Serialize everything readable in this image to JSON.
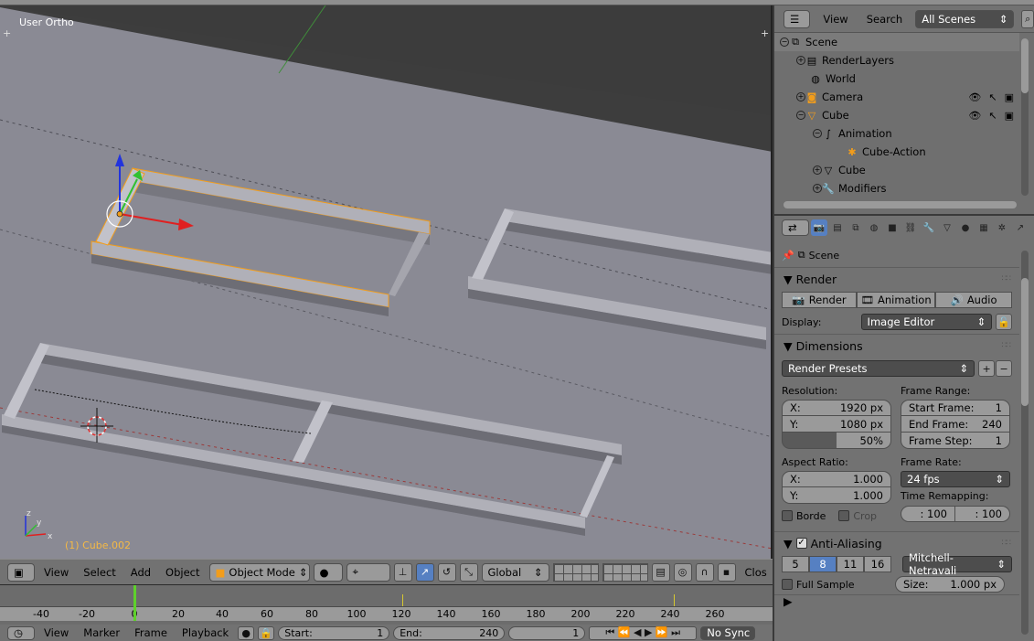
{
  "viewport": {
    "view_name": "User Ortho",
    "object_name": "(1) Cube.002",
    "axis_labels": {
      "x": "x",
      "y": "y",
      "z": "z"
    }
  },
  "view3d_header": {
    "menus": [
      "View",
      "Select",
      "Add",
      "Object"
    ],
    "mode": "Object Mode",
    "orientation": "Global",
    "truncated_label": "Clos"
  },
  "timeline": {
    "ticks": [
      "-40",
      "-20",
      "0",
      "20",
      "40",
      "60",
      "80",
      "100",
      "120",
      "140",
      "160",
      "180",
      "200",
      "220",
      "240",
      "260"
    ],
    "current_frame": 0,
    "menus": [
      "View",
      "Marker",
      "Frame",
      "Playback"
    ],
    "start_label": "Start:",
    "start_value": "1",
    "end_label": "End:",
    "end_value": "240",
    "current_value": "1",
    "sync": "No Sync"
  },
  "outliner": {
    "menus": [
      "View",
      "Search"
    ],
    "scene_filter": "All Scenes",
    "items": [
      {
        "label": "Scene",
        "level": 0,
        "icon": "scene-icon"
      },
      {
        "label": "RenderLayers",
        "level": 1,
        "icon": "renderlayers-icon"
      },
      {
        "label": "World",
        "level": 1,
        "icon": "world-icon"
      },
      {
        "label": "Camera",
        "level": 1,
        "icon": "camera-icon"
      },
      {
        "label": "Cube",
        "level": 1,
        "icon": "mesh-object-icon"
      },
      {
        "label": "Animation",
        "level": 2,
        "icon": "animation-icon"
      },
      {
        "label": "Cube-Action",
        "level": 3,
        "icon": "action-icon"
      },
      {
        "label": "Cube",
        "level": 2,
        "icon": "mesh-data-icon"
      },
      {
        "label": "Modifiers",
        "level": 2,
        "icon": "wrench-icon"
      }
    ]
  },
  "properties": {
    "context": "Scene",
    "render_panel": {
      "title": "Render",
      "buttons": [
        "Render",
        "Animation",
        "Audio"
      ],
      "display_label": "Display:",
      "display_value": "Image Editor"
    },
    "dimensions_panel": {
      "title": "Dimensions",
      "presets": "Render Presets",
      "resolution_label": "Resolution:",
      "res_x_label": "X:",
      "res_x": "1920 px",
      "res_y_label": "Y:",
      "res_y": "1080 px",
      "res_pct": "50%",
      "frame_range_label": "Frame Range:",
      "start_frame_label": "Start Frame:",
      "start_frame": "1",
      "end_frame_label": "End Frame:",
      "end_frame": "240",
      "frame_step_label": "Frame Step:",
      "frame_step": "1",
      "aspect_label": "Aspect Ratio:",
      "aspect_x_label": "X:",
      "aspect_x": "1.000",
      "aspect_y_label": "Y:",
      "aspect_y": "1.000",
      "frame_rate_label": "Frame Rate:",
      "frame_rate": "24 fps",
      "time_remap_label": "Time Remapping:",
      "remap_old": ": 100",
      "remap_new": ": 100",
      "border_label": "Borde",
      "crop_label": "Crop"
    },
    "aa_panel": {
      "title": "Anti-Aliasing",
      "samples": [
        "5",
        "8",
        "11",
        "16"
      ],
      "active_sample": "8",
      "filter": "Mitchell-Netravali",
      "full_sample_label": "Full Sample",
      "size_label": "Size:",
      "size_value": "1.000 px"
    }
  },
  "colors": {
    "selection": "#f29d1b",
    "playhead": "#5fd12c",
    "keyframe": "#d7c930",
    "active_blue": "#5680c2"
  }
}
